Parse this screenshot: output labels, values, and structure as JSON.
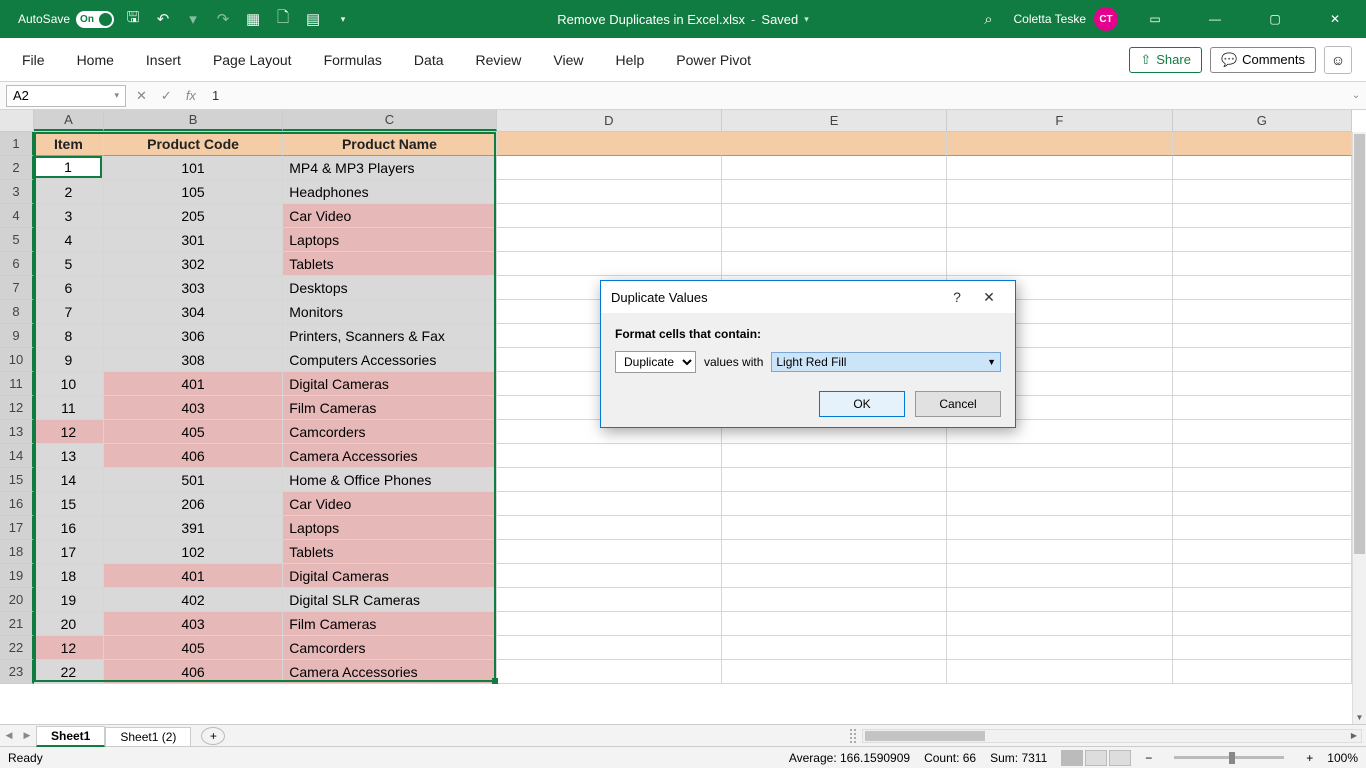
{
  "title": {
    "autosave": "AutoSave",
    "autosave_on": "On",
    "filename": "Remove Duplicates in Excel.xlsx",
    "saved": "Saved",
    "user": "Coletta Teske",
    "initials": "CT"
  },
  "ribbon": {
    "tabs": [
      "File",
      "Home",
      "Insert",
      "Page Layout",
      "Formulas",
      "Data",
      "Review",
      "View",
      "Help",
      "Power Pivot"
    ],
    "share": "Share",
    "comments": "Comments"
  },
  "formula": {
    "namebox": "A2",
    "value": "1"
  },
  "columns": [
    "A",
    "B",
    "C",
    "D",
    "E",
    "F",
    "G"
  ],
  "headers": {
    "A": "Item",
    "B": "Product Code",
    "C": "Product Name"
  },
  "rows": [
    {
      "n": "1",
      "a": "1",
      "b": "101",
      "c": "MP4 & MP3 Players",
      "dA": false,
      "dB": false,
      "dC": false
    },
    {
      "n": "2",
      "a": "2",
      "b": "105",
      "c": "Headphones",
      "dA": false,
      "dB": false,
      "dC": false
    },
    {
      "n": "3",
      "a": "3",
      "b": "205",
      "c": "Car Video",
      "dA": false,
      "dB": false,
      "dC": true
    },
    {
      "n": "4",
      "a": "4",
      "b": "301",
      "c": "Laptops",
      "dA": false,
      "dB": false,
      "dC": true
    },
    {
      "n": "5",
      "a": "5",
      "b": "302",
      "c": "Tablets",
      "dA": false,
      "dB": false,
      "dC": true
    },
    {
      "n": "6",
      "a": "6",
      "b": "303",
      "c": "Desktops",
      "dA": false,
      "dB": false,
      "dC": false
    },
    {
      "n": "7",
      "a": "7",
      "b": "304",
      "c": "Monitors",
      "dA": false,
      "dB": false,
      "dC": false
    },
    {
      "n": "8",
      "a": "8",
      "b": "306",
      "c": "Printers, Scanners & Fax",
      "dA": false,
      "dB": false,
      "dC": false
    },
    {
      "n": "9",
      "a": "9",
      "b": "308",
      "c": "Computers Accessories",
      "dA": false,
      "dB": false,
      "dC": false
    },
    {
      "n": "10",
      "a": "10",
      "b": "401",
      "c": "Digital Cameras",
      "dA": false,
      "dB": true,
      "dC": true
    },
    {
      "n": "11",
      "a": "11",
      "b": "403",
      "c": "Film Cameras",
      "dA": false,
      "dB": true,
      "dC": true
    },
    {
      "n": "12",
      "a": "12",
      "b": "405",
      "c": "Camcorders",
      "dA": true,
      "dB": true,
      "dC": true
    },
    {
      "n": "13",
      "a": "13",
      "b": "406",
      "c": "Camera Accessories",
      "dA": false,
      "dB": true,
      "dC": true
    },
    {
      "n": "14",
      "a": "14",
      "b": "501",
      "c": "Home & Office Phones",
      "dA": false,
      "dB": false,
      "dC": false
    },
    {
      "n": "15",
      "a": "15",
      "b": "206",
      "c": "Car Video",
      "dA": false,
      "dB": false,
      "dC": true
    },
    {
      "n": "16",
      "a": "16",
      "b": "391",
      "c": "Laptops",
      "dA": false,
      "dB": false,
      "dC": true
    },
    {
      "n": "17",
      "a": "17",
      "b": "102",
      "c": "Tablets",
      "dA": false,
      "dB": false,
      "dC": true
    },
    {
      "n": "18",
      "a": "18",
      "b": "401",
      "c": "Digital Cameras",
      "dA": false,
      "dB": true,
      "dC": true
    },
    {
      "n": "19",
      "a": "19",
      "b": "402",
      "c": "Digital SLR Cameras",
      "dA": false,
      "dB": false,
      "dC": false
    },
    {
      "n": "20",
      "a": "20",
      "b": "403",
      "c": "Film Cameras",
      "dA": false,
      "dB": true,
      "dC": true
    },
    {
      "n": "21",
      "a": "12",
      "b": "405",
      "c": "Camcorders",
      "dA": true,
      "dB": true,
      "dC": true
    },
    {
      "n": "22",
      "a": "22",
      "b": "406",
      "c": "Camera Accessories",
      "dA": false,
      "dB": true,
      "dC": true
    }
  ],
  "sheets": {
    "active": "Sheet1",
    "other": "Sheet1 (2)"
  },
  "status": {
    "ready": "Ready",
    "average": "Average: 166.1590909",
    "count": "Count: 66",
    "sum": "Sum: 7311",
    "zoom": "100%"
  },
  "dialog": {
    "title": "Duplicate Values",
    "label": "Format cells that contain:",
    "type": "Duplicate",
    "mid": "values with",
    "format": "Light Red Fill",
    "ok": "OK",
    "cancel": "Cancel"
  }
}
